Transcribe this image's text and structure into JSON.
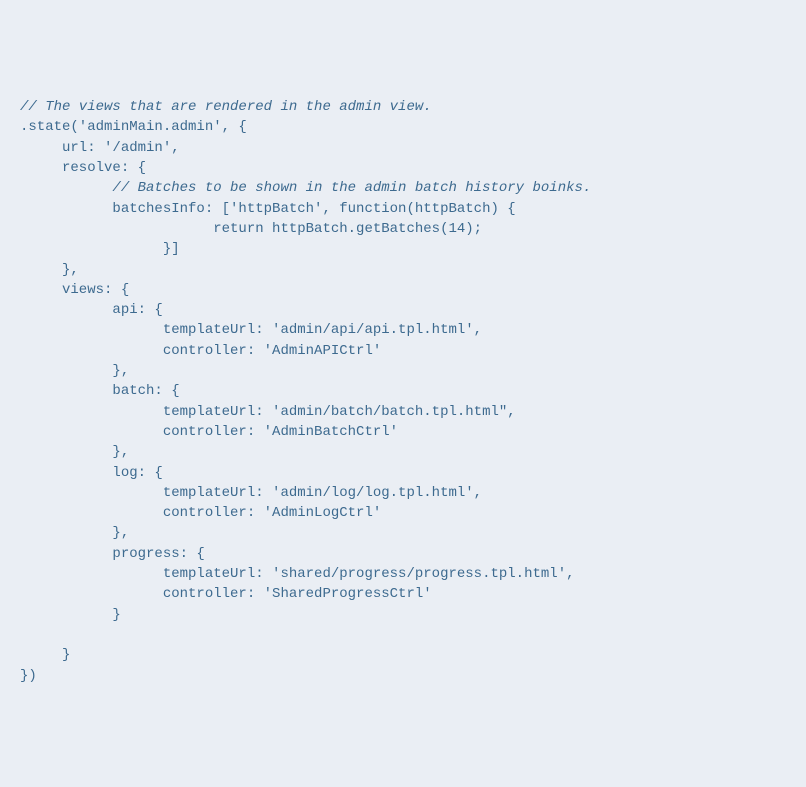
{
  "code": {
    "line1": "// The views that are rendered in the admin view.",
    "line2": ".state('adminMain.admin', {",
    "line3": "     url: '/admin',",
    "line4": "     resolve: {",
    "line5": "           // Batches to be shown in the admin batch history boinks.",
    "line6": "           batchesInfo: ['httpBatch', function(httpBatch) {",
    "line7": "                       return httpBatch.getBatches(14);",
    "line8": "                 }]",
    "line9": "     },",
    "line10": "     views: {",
    "line11": "           api: {",
    "line12": "                 templateUrl: 'admin/api/api.tpl.html',",
    "line13": "                 controller: 'AdminAPICtrl'",
    "line14": "           },",
    "line15": "           batch: {",
    "line16": "                 templateUrl: 'admin/batch/batch.tpl.html\",",
    "line17": "                 controller: 'AdminBatchCtrl'",
    "line18": "           },",
    "line19": "           log: {",
    "line20": "                 templateUrl: 'admin/log/log.tpl.html',",
    "line21": "                 controller: 'AdminLogCtrl'",
    "line22": "           },",
    "line23": "           progress: {",
    "line24": "                 templateUrl: 'shared/progress/progress.tpl.html',",
    "line25": "                 controller: 'SharedProgressCtrl'",
    "line26": "           }",
    "line27": "",
    "line28": "     }",
    "line29": "})"
  }
}
